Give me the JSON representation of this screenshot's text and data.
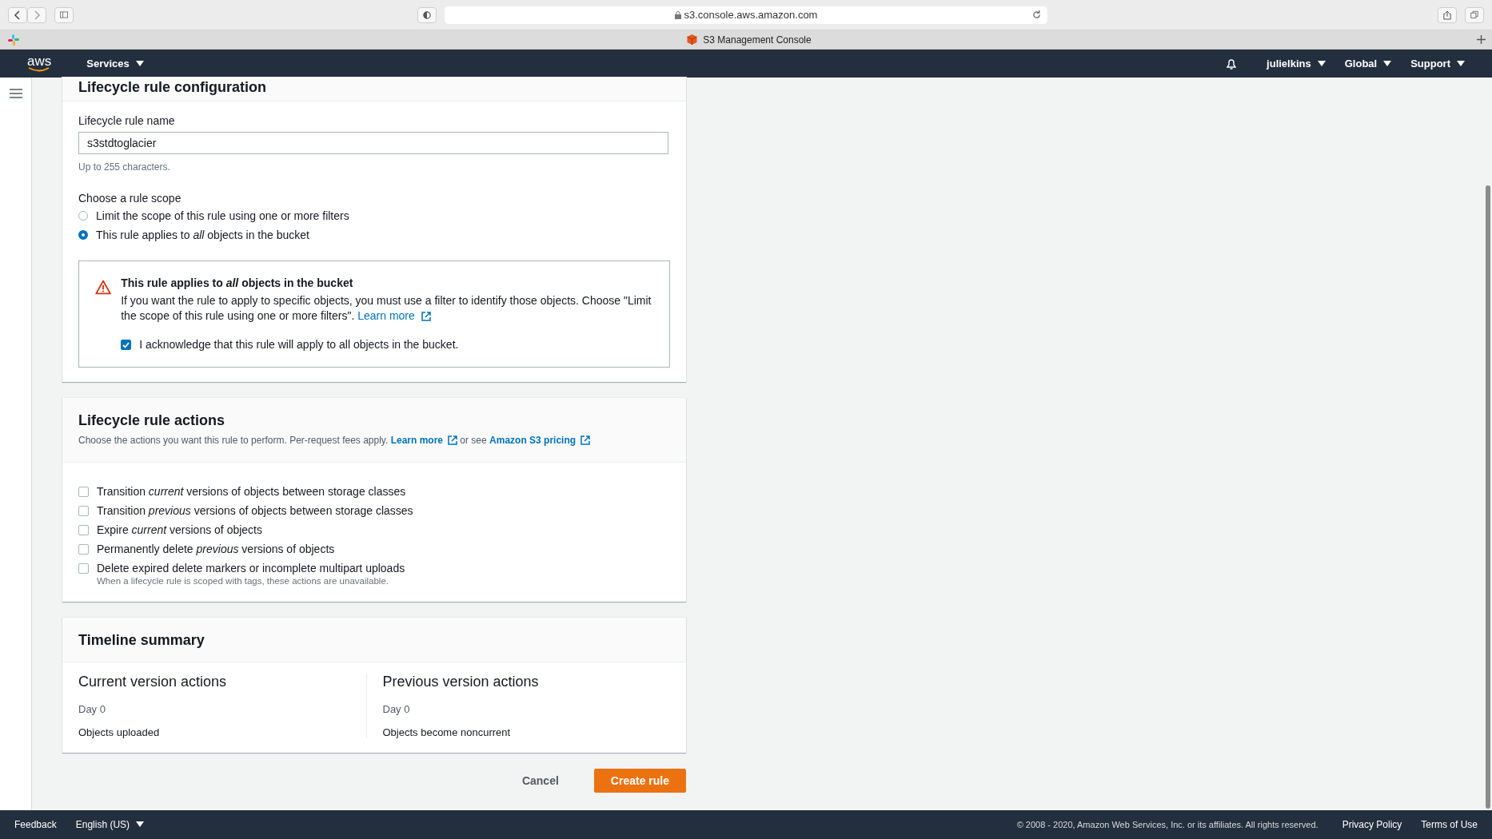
{
  "browser": {
    "url": "s3.console.aws.amazon.com",
    "tab_title": "S3 Management Console"
  },
  "nav": {
    "logo": "aws",
    "services": "Services",
    "user": "julielkins",
    "region": "Global",
    "support": "Support"
  },
  "configuration": {
    "title": "Lifecycle rule configuration",
    "name_label": "Lifecycle rule name",
    "name_value": "s3stdtoglacier",
    "name_hint": "Up to 255 characters.",
    "scope_label": "Choose a rule scope",
    "scope_options": [
      {
        "label": "Limit the scope of this rule using one or more filters",
        "selected": false
      },
      {
        "label": "This rule applies to *all* objects in the bucket",
        "selected": true
      }
    ],
    "alert": {
      "title": "This rule applies to *all* objects in the bucket",
      "text": "If you want the rule to apply to specific objects, you must use a filter to identify those objects. Choose \"Limit the scope of this rule using one or more filters\".",
      "link": "Learn more",
      "acknowledge": {
        "label": "I acknowledge that this rule will apply to all objects in the bucket.",
        "checked": true
      }
    }
  },
  "actions": {
    "title": "Lifecycle rule actions",
    "description": "Choose the actions you want this rule to perform. Per-request fees apply.",
    "learn_more": "Learn more",
    "joiner": "or see",
    "pricing": "Amazon S3 pricing",
    "options": [
      {
        "label": "Transition *current* versions of objects between storage classes",
        "checked": false
      },
      {
        "label": "Transition *previous* versions of objects between storage classes",
        "checked": false
      },
      {
        "label": "Expire *current* versions of objects",
        "checked": false
      },
      {
        "label": "Permanently delete *previous* versions of objects",
        "checked": false
      },
      {
        "label": "Delete expired delete markers or incomplete multipart uploads",
        "checked": false
      }
    ],
    "note": "When a lifecycle rule is scoped with tags, these actions are unavailable."
  },
  "timeline": {
    "title": "Timeline summary",
    "columns": [
      {
        "heading": "Current version actions",
        "day": "Day 0",
        "event": "Objects uploaded"
      },
      {
        "heading": "Previous version actions",
        "day": "Day 0",
        "event": "Objects become noncurrent"
      }
    ]
  },
  "buttons": {
    "cancel": "Cancel",
    "create": "Create rule"
  },
  "footer": {
    "feedback": "Feedback",
    "language": "English (US)",
    "copyright": "© 2008 - 2020, Amazon Web Services, Inc. or its affiliates. All rights reserved.",
    "privacy": "Privacy Policy",
    "terms": "Terms of Use"
  }
}
